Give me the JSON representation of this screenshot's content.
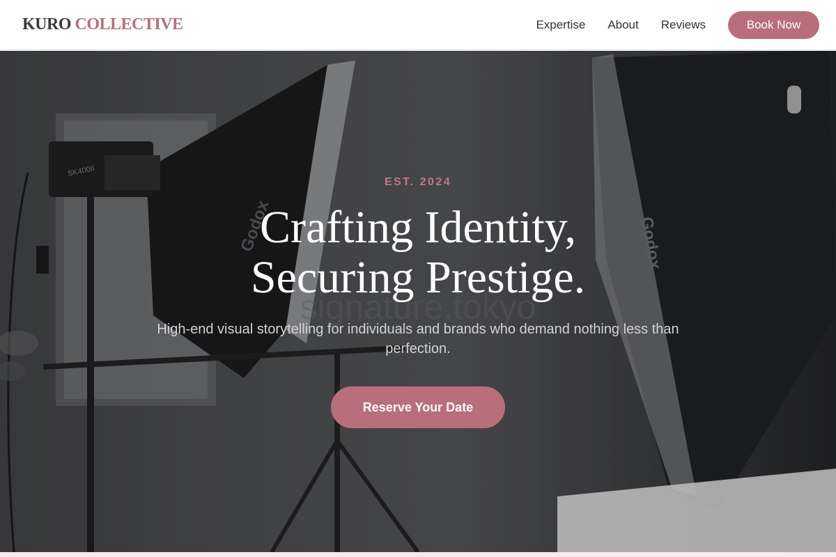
{
  "brand": {
    "name_part1": "KURO",
    "name_part2": "COLLECTIVE"
  },
  "nav": {
    "links": [
      "Expertise",
      "About",
      "Reviews"
    ],
    "cta_label": "Book Now"
  },
  "hero": {
    "eyebrow": "EST. 2024",
    "headline_line1": "Crafting Identity,",
    "headline_line2": "Securing Prestige.",
    "subtitle": "High-end visual storytelling for individuals and brands who demand nothing less than perfection.",
    "cta_label": "Reserve Your Date",
    "background_image": "photo-studio-softboxes",
    "watermark": "signature.tokyo"
  },
  "colors": {
    "accent": "#b86f7b",
    "eyebrow": "#c07a86",
    "nav_text": "#333333",
    "logo_dark": "#3a3a3a",
    "header_bg": "#ffffff"
  }
}
